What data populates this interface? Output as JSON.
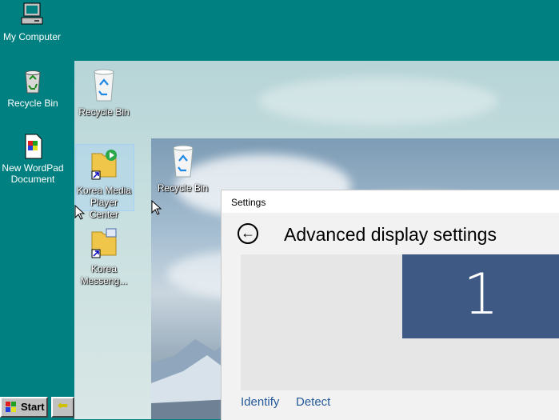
{
  "desktop_outer": {
    "icons": [
      {
        "label": "My Computer"
      },
      {
        "label": "Recycle Bin"
      },
      {
        "label": "New WordPad Document"
      }
    ]
  },
  "desktop_mid": {
    "icons": [
      {
        "label": "Recycle Bin"
      },
      {
        "label": "Korea Media Player Center"
      },
      {
        "label": "Korea Messeng..."
      }
    ]
  },
  "desktop_inner": {
    "icons": [
      {
        "label": "Recycle Bin"
      }
    ]
  },
  "settings": {
    "window_title": "Settings",
    "heading": "Advanced display settings",
    "monitor_number": "1",
    "links": {
      "identify": "Identify",
      "detect": "Detect"
    }
  },
  "taskbar": {
    "start_label": "Start"
  },
  "colors": {
    "desktop": "#008080",
    "monitor": "#3e5984",
    "link": "#255a99"
  }
}
